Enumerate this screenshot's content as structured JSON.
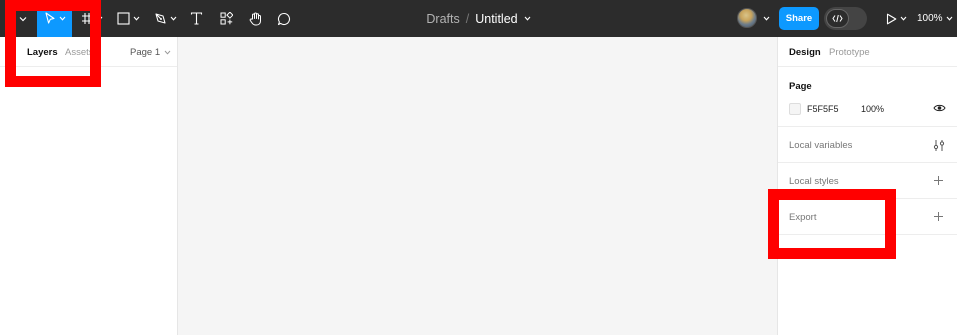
{
  "toolbar": {
    "breadcrumb": "Drafts",
    "separator": "/",
    "file_name": "Untitled",
    "share_label": "Share",
    "zoom": "100%"
  },
  "left_panel": {
    "tab_layers": "Layers",
    "tab_assets": "Assets",
    "page_selector": "Page 1"
  },
  "right_panel": {
    "tab_design": "Design",
    "tab_prototype": "Prototype",
    "page_section_title": "Page",
    "page_color": "F5F5F5",
    "page_opacity": "100%",
    "local_variables": "Local variables",
    "local_styles": "Local styles",
    "export": "Export"
  },
  "colors": {
    "toolbar_bg": "#2c2c2c",
    "accent": "#0d99ff",
    "canvas_bg": "#f5f5f5",
    "highlight": "#ff0000"
  },
  "icons": [
    "main-menu-chevron-icon",
    "move-tool-icon",
    "frame-tool-icon",
    "shape-tool-icon",
    "pen-tool-icon",
    "text-tool-icon",
    "resources-icon",
    "hand-tool-icon",
    "comment-icon",
    "present-icon",
    "eye-icon",
    "variables-icon",
    "plus-icon"
  ]
}
